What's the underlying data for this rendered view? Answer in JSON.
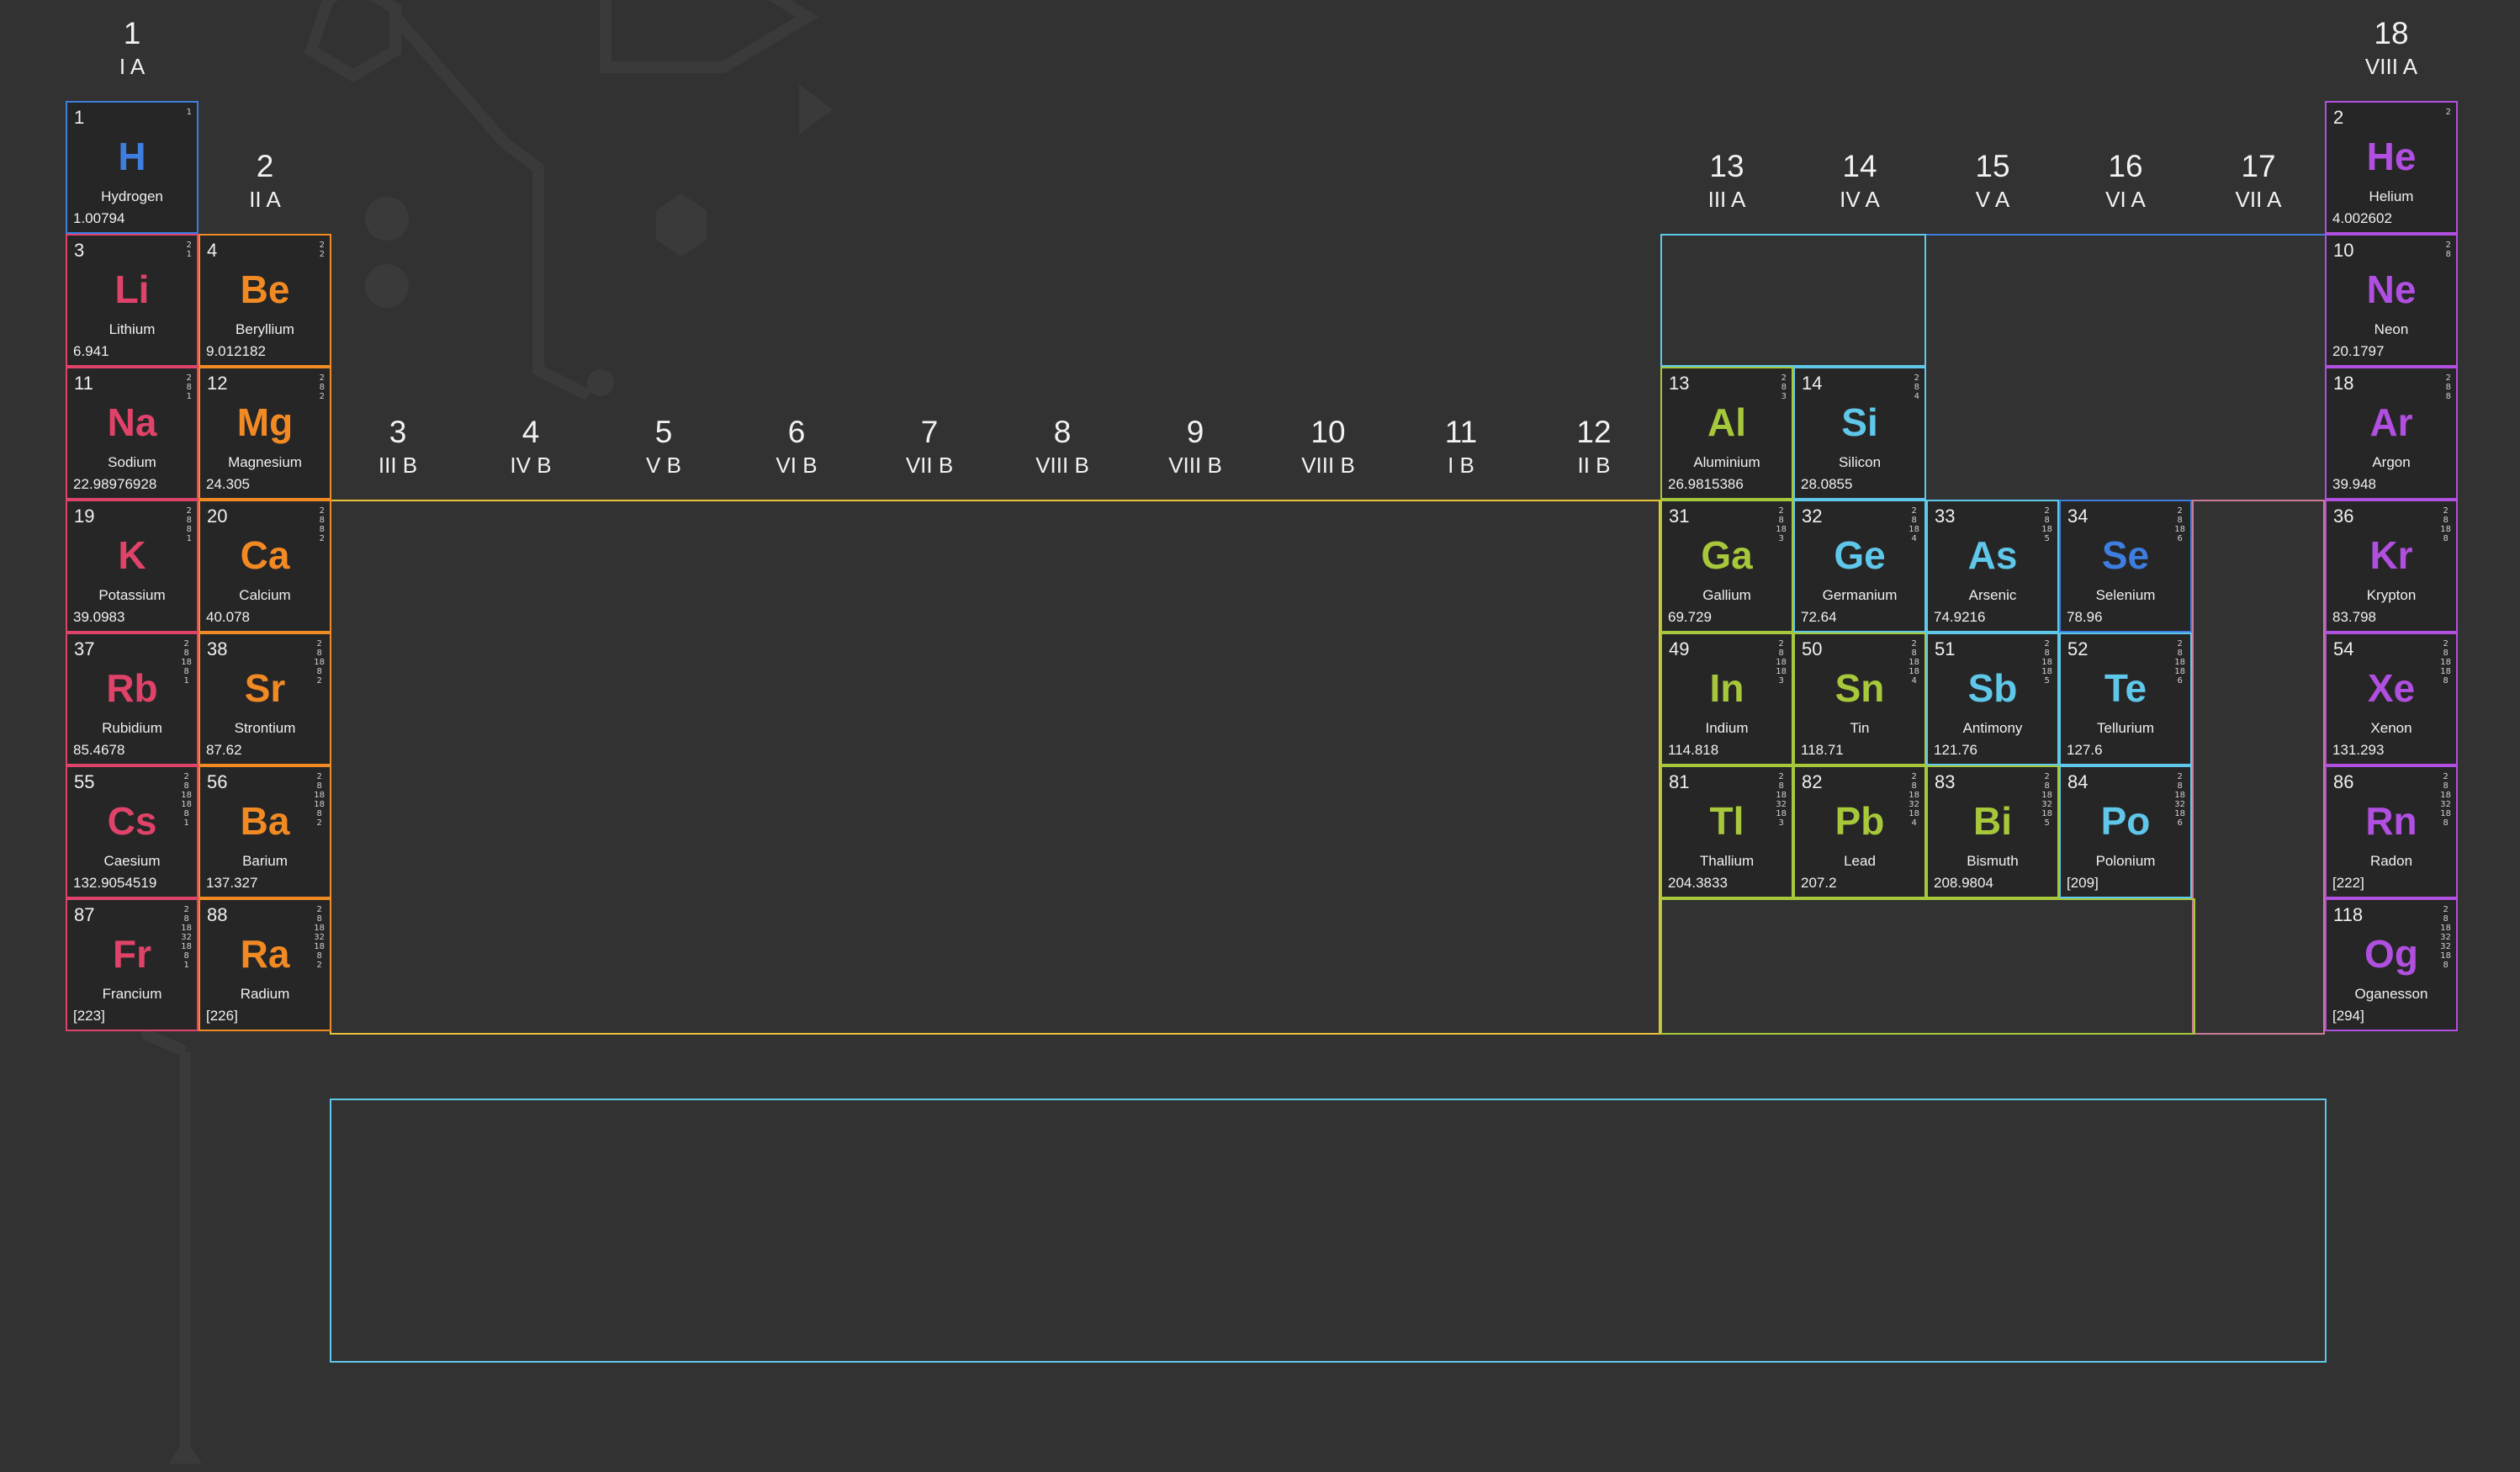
{
  "colors": {
    "background": "#323232",
    "cell_background": "#262626",
    "hydrogen": "#3d7ee0",
    "alkali": "#e0436a",
    "alkaline_earth": "#f28a24",
    "transition": "#e8c43a",
    "post_transition": "#a6c83a",
    "metalloid": "#5fc8ea",
    "nonmetal": "#3d7ee0",
    "noble_gas": "#b04fe0",
    "f_block": "#5fc8ea"
  },
  "groups": [
    {
      "number": "1",
      "roman": "I A"
    },
    {
      "number": "2",
      "roman": "II A"
    },
    {
      "number": "3",
      "roman": "III B"
    },
    {
      "number": "4",
      "roman": "IV B"
    },
    {
      "number": "5",
      "roman": "V B"
    },
    {
      "number": "6",
      "roman": "VI B"
    },
    {
      "number": "7",
      "roman": "VII B"
    },
    {
      "number": "8",
      "roman": "VIII B"
    },
    {
      "number": "9",
      "roman": "VIII B"
    },
    {
      "number": "10",
      "roman": "VIII B"
    },
    {
      "number": "11",
      "roman": "I B"
    },
    {
      "number": "12",
      "roman": "II B"
    },
    {
      "number": "13",
      "roman": "III A"
    },
    {
      "number": "14",
      "roman": "IV A"
    },
    {
      "number": "15",
      "roman": "V A"
    },
    {
      "number": "16",
      "roman": "VI A"
    },
    {
      "number": "17",
      "roman": "VII A"
    },
    {
      "number": "18",
      "roman": "VIII A"
    }
  ],
  "elements": [
    {
      "number": "1",
      "symbol": "H",
      "name": "Hydrogen",
      "mass": "1.00794",
      "shells": "1",
      "category": "hydrogen",
      "group": 1,
      "period": 1
    },
    {
      "number": "2",
      "symbol": "He",
      "name": "Helium",
      "mass": "4.002602",
      "shells": "2",
      "category": "noble_gas",
      "group": 18,
      "period": 1
    },
    {
      "number": "3",
      "symbol": "Li",
      "name": "Lithium",
      "mass": "6.941",
      "shells": "2\n1",
      "category": "alkali",
      "group": 1,
      "period": 2
    },
    {
      "number": "4",
      "symbol": "Be",
      "name": "Beryllium",
      "mass": "9.012182",
      "shells": "2\n2",
      "category": "alkaline_earth",
      "group": 2,
      "period": 2
    },
    {
      "number": "10",
      "symbol": "Ne",
      "name": "Neon",
      "mass": "20.1797",
      "shells": "2\n8",
      "category": "noble_gas",
      "group": 18,
      "period": 2
    },
    {
      "number": "11",
      "symbol": "Na",
      "name": "Sodium",
      "mass": "22.98976928",
      "shells": "2\n8\n1",
      "category": "alkali",
      "group": 1,
      "period": 3
    },
    {
      "number": "12",
      "symbol": "Mg",
      "name": "Magnesium",
      "mass": "24.305",
      "shells": "2\n8\n2",
      "category": "alkaline_earth",
      "group": 2,
      "period": 3
    },
    {
      "number": "13",
      "symbol": "Al",
      "name": "Aluminium",
      "mass": "26.9815386",
      "shells": "2\n8\n3",
      "category": "post_transition",
      "group": 13,
      "period": 3
    },
    {
      "number": "14",
      "symbol": "Si",
      "name": "Silicon",
      "mass": "28.0855",
      "shells": "2\n8\n4",
      "category": "metalloid",
      "group": 14,
      "period": 3
    },
    {
      "number": "18",
      "symbol": "Ar",
      "name": "Argon",
      "mass": "39.948",
      "shells": "2\n8\n8",
      "category": "noble_gas",
      "group": 18,
      "period": 3
    },
    {
      "number": "19",
      "symbol": "K",
      "name": "Potassium",
      "mass": "39.0983",
      "shells": "2\n8\n8\n1",
      "category": "alkali",
      "group": 1,
      "period": 4
    },
    {
      "number": "20",
      "symbol": "Ca",
      "name": "Calcium",
      "mass": "40.078",
      "shells": "2\n8\n8\n2",
      "category": "alkaline_earth",
      "group": 2,
      "period": 4
    },
    {
      "number": "31",
      "symbol": "Ga",
      "name": "Gallium",
      "mass": "69.729",
      "shells": "2\n8\n18\n3",
      "category": "post_transition",
      "group": 13,
      "period": 4
    },
    {
      "number": "32",
      "symbol": "Ge",
      "name": "Germanium",
      "mass": "72.64",
      "shells": "2\n8\n18\n4",
      "category": "metalloid",
      "group": 14,
      "period": 4
    },
    {
      "number": "33",
      "symbol": "As",
      "name": "Arsenic",
      "mass": "74.9216",
      "shells": "2\n8\n18\n5",
      "category": "metalloid",
      "group": 15,
      "period": 4
    },
    {
      "number": "34",
      "symbol": "Se",
      "name": "Selenium",
      "mass": "78.96",
      "shells": "2\n8\n18\n6",
      "category": "nonmetal",
      "group": 16,
      "period": 4
    },
    {
      "number": "36",
      "symbol": "Kr",
      "name": "Krypton",
      "mass": "83.798",
      "shells": "2\n8\n18\n8",
      "category": "noble_gas",
      "group": 18,
      "period": 4
    },
    {
      "number": "37",
      "symbol": "Rb",
      "name": "Rubidium",
      "mass": "85.4678",
      "shells": "2\n8\n18\n8\n1",
      "category": "alkali",
      "group": 1,
      "period": 5
    },
    {
      "number": "38",
      "symbol": "Sr",
      "name": "Strontium",
      "mass": "87.62",
      "shells": "2\n8\n18\n8\n2",
      "category": "alkaline_earth",
      "group": 2,
      "period": 5
    },
    {
      "number": "49",
      "symbol": "In",
      "name": "Indium",
      "mass": "114.818",
      "shells": "2\n8\n18\n18\n3",
      "category": "post_transition",
      "group": 13,
      "period": 5
    },
    {
      "number": "50",
      "symbol": "Sn",
      "name": "Tin",
      "mass": "118.71",
      "shells": "2\n8\n18\n18\n4",
      "category": "post_transition",
      "group": 14,
      "period": 5
    },
    {
      "number": "51",
      "symbol": "Sb",
      "name": "Antimony",
      "mass": "121.76",
      "shells": "2\n8\n18\n18\n5",
      "category": "metalloid",
      "group": 15,
      "period": 5
    },
    {
      "number": "52",
      "symbol": "Te",
      "name": "Tellurium",
      "mass": "127.6",
      "shells": "2\n8\n18\n18\n6",
      "category": "metalloid",
      "group": 16,
      "period": 5
    },
    {
      "number": "54",
      "symbol": "Xe",
      "name": "Xenon",
      "mass": "131.293",
      "shells": "2\n8\n18\n18\n8",
      "category": "noble_gas",
      "group": 18,
      "period": 5
    },
    {
      "number": "55",
      "symbol": "Cs",
      "name": "Caesium",
      "mass": "132.9054519",
      "shells": "2\n8\n18\n18\n8\n1",
      "category": "alkali",
      "group": 1,
      "period": 6
    },
    {
      "number": "56",
      "symbol": "Ba",
      "name": "Barium",
      "mass": "137.327",
      "shells": "2\n8\n18\n18\n8\n2",
      "category": "alkaline_earth",
      "group": 2,
      "period": 6
    },
    {
      "number": "81",
      "symbol": "Tl",
      "name": "Thallium",
      "mass": "204.3833",
      "shells": "2\n8\n18\n32\n18\n3",
      "category": "post_transition",
      "group": 13,
      "period": 6
    },
    {
      "number": "82",
      "symbol": "Pb",
      "name": "Lead",
      "mass": "207.2",
      "shells": "2\n8\n18\n32\n18\n4",
      "category": "post_transition",
      "group": 14,
      "period": 6
    },
    {
      "number": "83",
      "symbol": "Bi",
      "name": "Bismuth",
      "mass": "208.9804",
      "shells": "2\n8\n18\n32\n18\n5",
      "category": "post_transition",
      "group": 15,
      "period": 6
    },
    {
      "number": "84",
      "symbol": "Po",
      "name": "Polonium",
      "mass": "[209]",
      "shells": "2\n8\n18\n32\n18\n6",
      "category": "metalloid",
      "group": 16,
      "period": 6
    },
    {
      "number": "86",
      "symbol": "Rn",
      "name": "Radon",
      "mass": "[222]",
      "shells": "2\n8\n18\n32\n18\n8",
      "category": "noble_gas",
      "group": 18,
      "period": 6
    },
    {
      "number": "87",
      "symbol": "Fr",
      "name": "Francium",
      "mass": "[223]",
      "shells": "2\n8\n18\n32\n18\n8\n1",
      "category": "alkali",
      "group": 1,
      "period": 7
    },
    {
      "number": "88",
      "symbol": "Ra",
      "name": "Radium",
      "mass": "[226]",
      "shells": "2\n8\n18\n32\n18\n8\n2",
      "category": "alkaline_earth",
      "group": 2,
      "period": 7
    },
    {
      "number": "118",
      "symbol": "Og",
      "name": "Oganesson",
      "mass": "[294]",
      "shells": "2\n8\n18\n32\n32\n18\n8",
      "category": "noble_gas",
      "group": 18,
      "period": 7
    }
  ]
}
